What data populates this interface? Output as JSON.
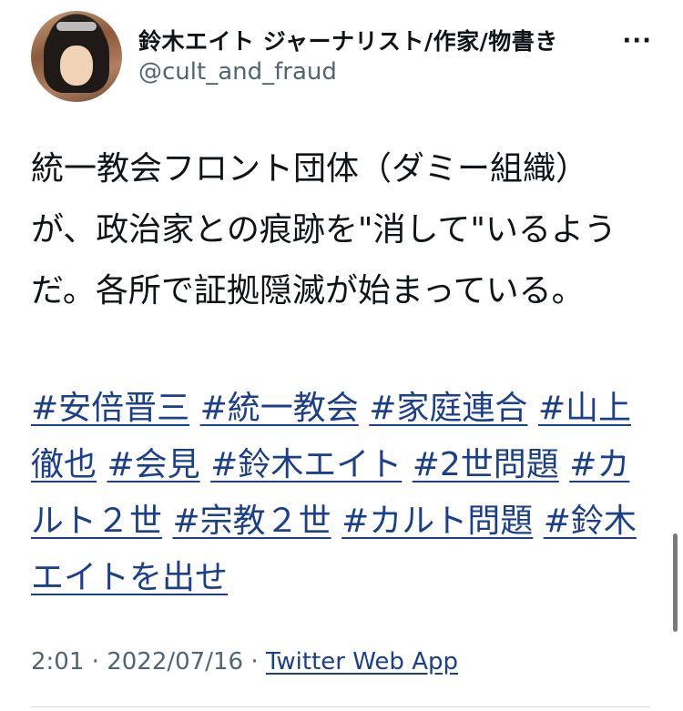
{
  "author": {
    "display_name": "鈴木エイト ジャーナリスト/作家/物書き",
    "handle": "@cult_and_fraud"
  },
  "header": {
    "more_label": "···"
  },
  "tweet": {
    "text": "統一教会フロント団体（ダミー組織）が、政治家との痕跡を\"消して\"いるようだ。各所で証拠隠滅が始まっている。",
    "hashtags": [
      "#安倍晋三",
      "#統一教会",
      "#家庭連合",
      "#山上徹也",
      "#会見",
      "#鈴木エイト",
      "#2世問題",
      "#カルト２世",
      "#宗教２世",
      "#カルト問題",
      "#鈴木エイトを出せ"
    ],
    "time": "2:01",
    "separator": "·",
    "date": "2022/07/16",
    "source": "Twitter Web App"
  },
  "colors": {
    "link": "#1b3f8a",
    "secondary_text": "#536471",
    "primary_text": "#0f1419"
  }
}
